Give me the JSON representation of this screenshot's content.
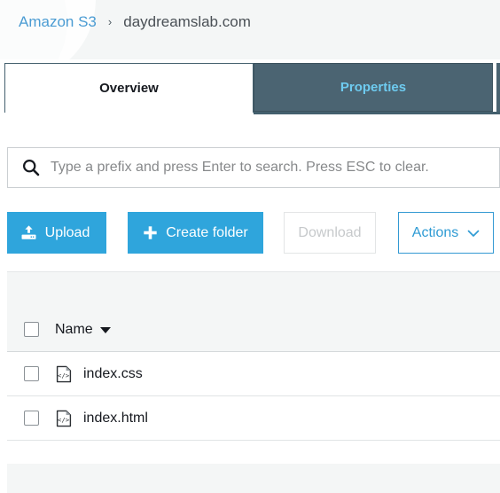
{
  "breadcrumb": {
    "root_label": "Amazon S3",
    "separator": "›",
    "current_label": "daydreamslab.com"
  },
  "tabs": [
    {
      "id": "overview",
      "label": "Overview",
      "active": true
    },
    {
      "id": "properties",
      "label": "Properties",
      "active": false
    }
  ],
  "search": {
    "icon": "search-icon",
    "value": "",
    "placeholder": "Type a prefix and press Enter to search. Press ESC to clear."
  },
  "toolbar": {
    "upload_label": "Upload",
    "upload_icon": "upload-icon",
    "create_folder_label": "Create folder",
    "create_folder_icon": "plus-icon",
    "download_label": "Download",
    "actions_label": "Actions",
    "actions_icon": "chevron-down-icon"
  },
  "table": {
    "columns": [
      {
        "id": "select",
        "label": ""
      },
      {
        "id": "name",
        "label": "Name",
        "sort": "desc",
        "sort_icon": "caret-down-icon"
      }
    ],
    "rows": [
      {
        "name": "index.css",
        "icon": "code-file-icon",
        "selected": false
      },
      {
        "name": "index.html",
        "icon": "code-file-icon",
        "selected": false
      }
    ]
  },
  "colors": {
    "accent_blue": "#2fa5dc",
    "link_blue": "#4b9cd3",
    "tab_active_text": "#16191f",
    "tab_inactive_bg": "#4b6472",
    "tab_inactive_text": "#6ecbf0",
    "page_bg": "#ffffff",
    "band_bg": "#f4f6f6",
    "border": "#cbcfd2",
    "disabled_text": "#c6c9cb"
  }
}
